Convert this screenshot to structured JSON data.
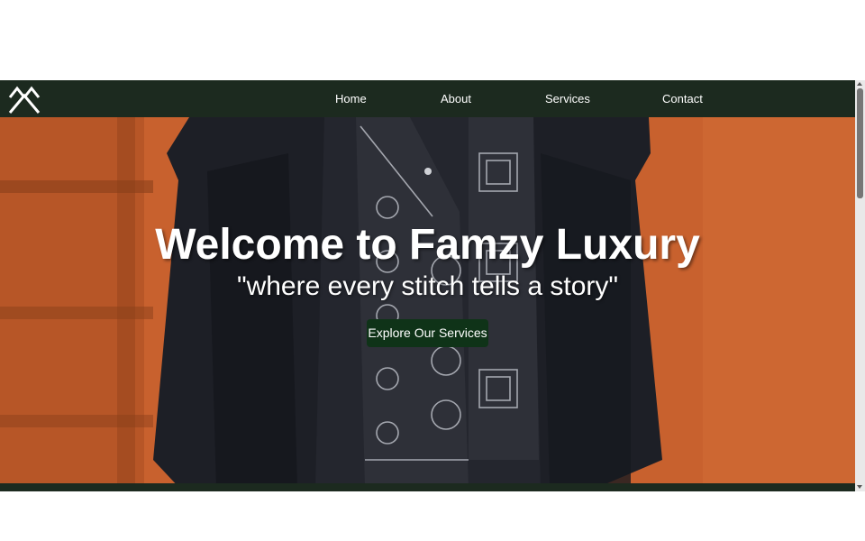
{
  "colors": {
    "nav_background": "#1c2a1f",
    "hero_background": "#c8612e",
    "cta_background": "#0f3318",
    "text": "#ffffff"
  },
  "nav": {
    "logo_icon": "crossed-chevron-logo-icon",
    "items": [
      {
        "label": "Home"
      },
      {
        "label": "About"
      },
      {
        "label": "Services"
      },
      {
        "label": "Contact"
      }
    ]
  },
  "hero": {
    "title": "Welcome to Famzy Luxury",
    "tagline": "\"where every stitch tells a story\"",
    "cta_label": "Explore Our Services",
    "background_image": "black embroidered agbada garment on orange backdrop"
  }
}
